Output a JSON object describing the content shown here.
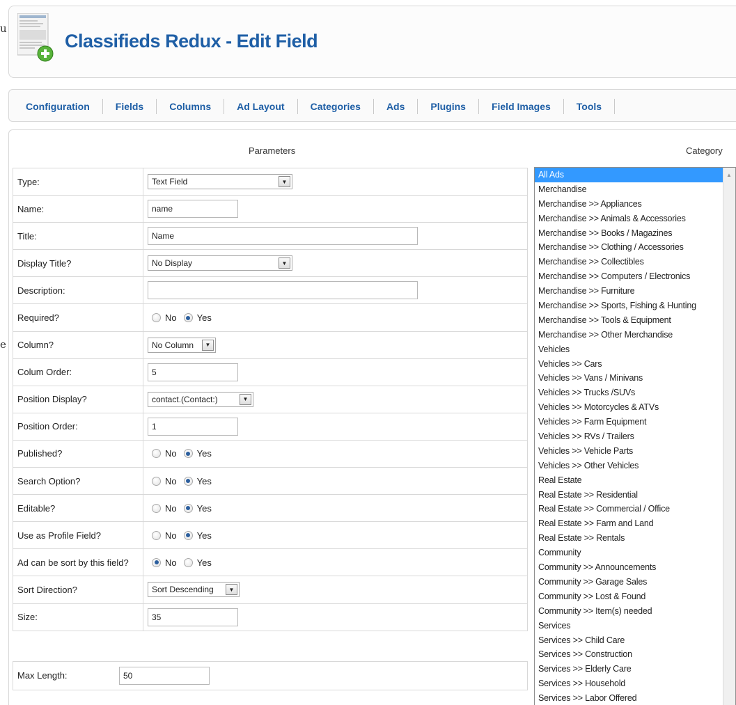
{
  "header": {
    "title": "Classifieds Redux - Edit Field"
  },
  "menu": [
    "Configuration",
    "Fields",
    "Columns",
    "Ad Layout",
    "Categories",
    "Ads",
    "Plugins",
    "Field Images",
    "Tools"
  ],
  "sections": {
    "parameters": "Parameters",
    "category": "Category"
  },
  "options": {
    "no": "No",
    "yes": "Yes"
  },
  "form": {
    "type": {
      "label": "Type:",
      "value": "Text Field"
    },
    "name": {
      "label": "Name:",
      "value": "name"
    },
    "title": {
      "label": "Title:",
      "value": "Name"
    },
    "display_title": {
      "label": "Display Title?",
      "value": "No Display"
    },
    "description": {
      "label": "Description:",
      "value": ""
    },
    "required": {
      "label": "Required?",
      "selected": "Yes"
    },
    "column": {
      "label": "Column?",
      "value": "No Column"
    },
    "column_order": {
      "label": "Colum Order:",
      "value": "5"
    },
    "position_display": {
      "label": "Position Display?",
      "value": "contact.(Contact:)"
    },
    "position_order": {
      "label": "Position Order:",
      "value": "1"
    },
    "published": {
      "label": "Published?",
      "selected": "Yes"
    },
    "search_option": {
      "label": "Search Option?",
      "selected": "Yes"
    },
    "editable": {
      "label": "Editable?",
      "selected": "Yes"
    },
    "profile_field": {
      "label": "Use as Profile Field?",
      "selected": "Yes"
    },
    "sortable": {
      "label": "Ad can be sort by this field?",
      "selected": "No"
    },
    "sort_direction": {
      "label": "Sort Direction?",
      "value": "Sort Descending"
    },
    "size": {
      "label": "Size:",
      "value": "35"
    },
    "max_length": {
      "label": "Max Length:",
      "value": "50"
    }
  },
  "categories": [
    "All Ads",
    "Merchandise",
    "Merchandise >> Appliances",
    "Merchandise >> Animals & Accessories",
    "Merchandise >> Books / Magazines",
    "Merchandise >> Clothing / Accessories",
    "Merchandise >> Collectibles",
    "Merchandise >> Computers / Electronics",
    "Merchandise >> Furniture",
    "Merchandise >> Sports, Fishing & Hunting",
    "Merchandise >> Tools & Equipment",
    "Merchandise >> Other Merchandise",
    "Vehicles",
    "Vehicles >> Cars",
    "Vehicles >> Vans / Minivans",
    "Vehicles >> Trucks /SUVs",
    "Vehicles >> Motorcycles & ATVs",
    "Vehicles >> Farm Equipment",
    "Vehicles >> RVs / Trailers",
    "Vehicles >> Vehicle Parts",
    "Vehicles >> Other Vehicles",
    "Real Estate",
    "Real Estate >> Residential",
    "Real Estate >> Commercial / Office",
    "Real Estate >> Farm and Land",
    "Real Estate >> Rentals",
    "Community",
    "Community >> Announcements",
    "Community >> Garage Sales",
    "Community >> Lost & Found",
    "Community >> Item(s) needed",
    "Services",
    "Services >> Child Care",
    "Services >> Construction",
    "Services >> Elderly Care",
    "Services >> Household",
    "Services >> Labor Offered"
  ],
  "selected_category": "All Ads",
  "edge_chars": [
    "u",
    "e"
  ]
}
